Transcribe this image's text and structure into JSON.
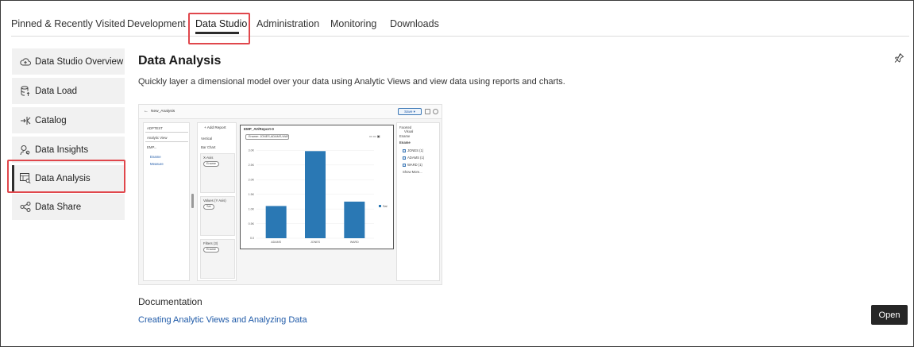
{
  "tabs": [
    {
      "label": "Pinned & Recently Visited"
    },
    {
      "label": "Development"
    },
    {
      "label": "Data Studio",
      "active": true
    },
    {
      "label": "Administration"
    },
    {
      "label": "Monitoring"
    },
    {
      "label": "Downloads"
    }
  ],
  "sidebar": {
    "items": [
      {
        "label": "Data Studio Overview",
        "icon": "cloud-icon"
      },
      {
        "label": "Data Load",
        "icon": "database-upload-icon"
      },
      {
        "label": "Catalog",
        "icon": "catalog-icon"
      },
      {
        "label": "Data Insights",
        "icon": "insights-search-icon"
      },
      {
        "label": "Data Analysis",
        "icon": "analysis-icon",
        "active": true
      },
      {
        "label": "Data Share",
        "icon": "share-icon"
      }
    ]
  },
  "main": {
    "title": "Data Analysis",
    "description": "Quickly layer a dimensional model over your data using Analytic Views and view data using reports and charts.",
    "documentation_heading": "Documentation",
    "documentation_link": "Creating Analytic Views and Analyzing Data",
    "open_label": "Open"
  },
  "preview": {
    "back": "←",
    "name": "New_Analysis",
    "save_label": "Save ▾",
    "left_panel": {
      "schema": "ADPTEST",
      "source_type": "Analytic View",
      "source": "EMP...",
      "tree": [
        "Ename",
        "Measure"
      ]
    },
    "mid_panel": {
      "add_report": "+ Add Report",
      "orientation": "Vertical",
      "chart_type": "Bar Chart",
      "xaxis_label": "X-Axis",
      "xaxis_pill": "Ename",
      "values_label": "Values (Y Axis)",
      "values_pill": "Sal",
      "filters_label": "Filters (3)",
      "filters_pill": "Ename"
    },
    "chart_title": "EMP_AV/Report-0",
    "filter_text": "Ename: JONES,ADAMS,WARD",
    "legend": "Sal",
    "right_panel": {
      "faceted": "Faceted",
      "visual": "Visual",
      "heading": "Ename",
      "header2": "Ename",
      "members": [
        "JONES (1)",
        "ADAMS (1)",
        "WARD (1)"
      ],
      "show_more": "Show More..."
    }
  },
  "chart_data": {
    "type": "bar",
    "categories": [
      "ADAMS",
      "JONES",
      "WARD"
    ],
    "series": [
      {
        "name": "Sal",
        "values": [
          1100,
          2975,
          1250
        ]
      }
    ],
    "ylim": [
      0,
      3200
    ],
    "yticks": [
      "0.0",
      "0.5K",
      "1.0K",
      "1.5K",
      "2.0K",
      "2.5K",
      "3.0K"
    ],
    "color": "#2a78b4"
  },
  "colors": {
    "highlight": "#e0474c",
    "link": "#1f5aa8",
    "open_button": "#262626",
    "sidebar_bg": "#f1f1f1"
  }
}
